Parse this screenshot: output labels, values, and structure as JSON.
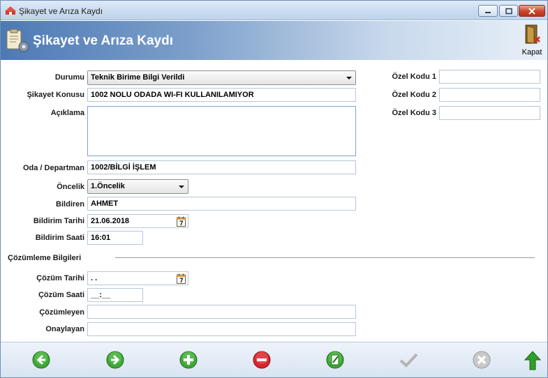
{
  "window": {
    "title": "Şikayet ve Arıza Kaydı"
  },
  "header": {
    "title": "Şikayet ve Arıza Kaydı",
    "close_label": "Kapat"
  },
  "form": {
    "durumu": {
      "label": "Durumu",
      "value": "Teknik Birime Bilgi Verildi"
    },
    "sikayet_konusu": {
      "label": "Şikayet Konusu",
      "value": "1002 NOLU ODADA WI-FI KULLANILAMIYOR"
    },
    "aciklama": {
      "label": "Açıklama",
      "value": ""
    },
    "oda_departman": {
      "label": "Oda / Departman",
      "value": "1002/BİLGİ İŞLEM"
    },
    "oncelik": {
      "label": "Öncelik",
      "value": "1.Öncelik"
    },
    "bildiren": {
      "label": "Bildiren",
      "value": "AHMET"
    },
    "bildirim_tarihi": {
      "label": "Bildirim Tarihi",
      "value": "21.06.2018"
    },
    "bildirim_saati": {
      "label": "Bildirim Saati",
      "value": "16:01"
    },
    "ozel_kodu_1": {
      "label": "Özel Kodu 1",
      "value": ""
    },
    "ozel_kodu_2": {
      "label": "Özel Kodu 2",
      "value": ""
    },
    "ozel_kodu_3": {
      "label": "Özel Kodu 3",
      "value": ""
    }
  },
  "resolution": {
    "section_title": "Çözümleme Bilgileri",
    "cozum_tarihi": {
      "label": "Çözüm Tarihi",
      "value": " .  ."
    },
    "cozum_saati": {
      "label": "Çözüm Saati",
      "value": "__:__"
    },
    "cozumleyen": {
      "label": "Çözümleyen",
      "value": ""
    },
    "onaylayan": {
      "label": "Onaylayan",
      "value": ""
    }
  },
  "toolbar": {
    "icons": [
      "prev-icon",
      "next-icon",
      "add-icon",
      "delete-icon",
      "edit-icon",
      "confirm-icon",
      "cancel-icon",
      "up-icon"
    ],
    "colors": {
      "green": "#3ea83a",
      "red": "#d8242a",
      "gray": "#b4b4b4"
    }
  },
  "colors": {
    "header_start": "#4d79b4",
    "header_end": "#e9f0f8"
  }
}
